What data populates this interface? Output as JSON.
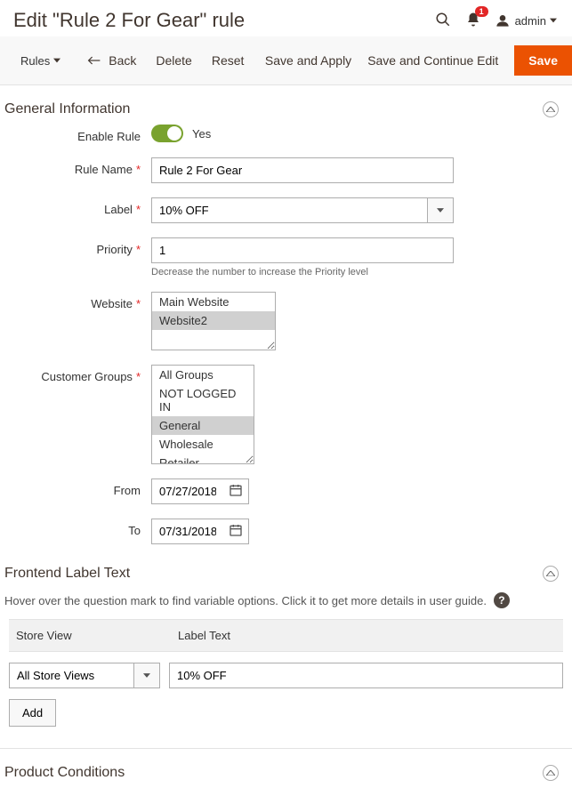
{
  "header": {
    "title": "Edit \"Rule 2 For Gear\" rule",
    "notification_count": "1",
    "user": "admin"
  },
  "toolbar": {
    "rules_label": "Rules",
    "back_label": "Back",
    "delete_label": "Delete",
    "reset_label": "Reset",
    "save_apply_label": "Save and Apply",
    "save_continue_label": "Save and Continue Edit",
    "save_label": "Save"
  },
  "sections": {
    "general": {
      "title": "General Information"
    },
    "frontend": {
      "title": "Frontend Label Text",
      "note": "Hover over the question mark to find variable options. Click it to get more details in user guide."
    },
    "conditions": {
      "title": "Product Conditions"
    }
  },
  "fields": {
    "enable_rule": {
      "label": "Enable Rule",
      "value_text": "Yes"
    },
    "rule_name": {
      "label": "Rule Name",
      "value": "Rule 2 For Gear"
    },
    "label": {
      "label": "Label",
      "value": "10% OFF"
    },
    "priority": {
      "label": "Priority",
      "value": "1",
      "hint": "Decrease the number to increase the Priority level"
    },
    "website": {
      "label": "Website",
      "options": [
        "Main Website",
        "Website2"
      ],
      "selected": [
        "Website2"
      ]
    },
    "customer_groups": {
      "label": "Customer Groups",
      "options": [
        "All Groups",
        "NOT LOGGED IN",
        "General",
        "Wholesale",
        "Retailer"
      ],
      "selected": [
        "General"
      ]
    },
    "from": {
      "label": "From",
      "value": "07/27/2018"
    },
    "to": {
      "label": "To",
      "value": "07/31/2018"
    }
  },
  "frontend_table": {
    "col1": "Store View",
    "col2": "Label Text",
    "store_view_value": "All Store Views",
    "label_text_value": "10% OFF",
    "add_label": "Add"
  }
}
